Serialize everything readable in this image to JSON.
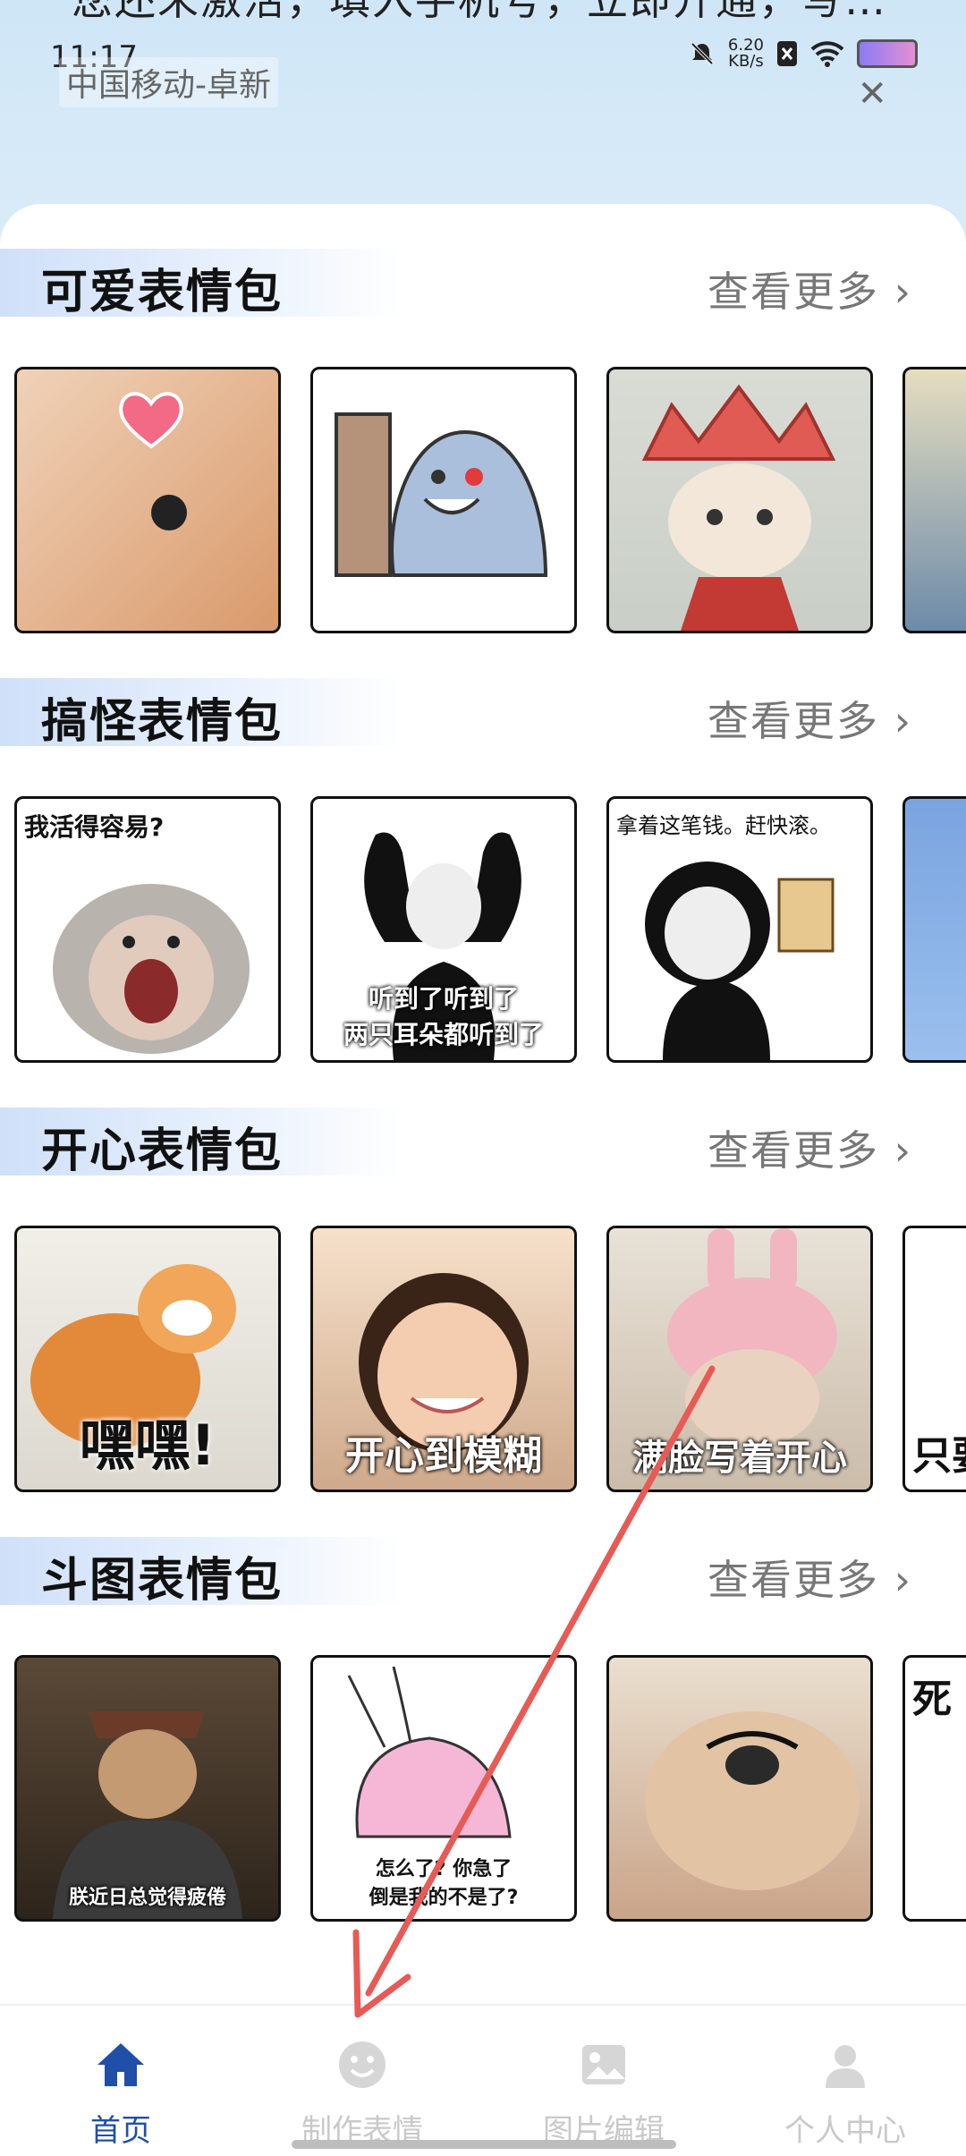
{
  "banner": {
    "text": "您还未激活，填入手机号，立即开通，写…"
  },
  "status_bar": {
    "time": "11:17",
    "carrier": "中国移动-卓新",
    "net_speed_value": "6.20",
    "net_speed_unit": "KB/s"
  },
  "sections": [
    {
      "title": "可爱表情包",
      "more": "查看更多"
    },
    {
      "title": "搞怪表情包",
      "more": "查看更多",
      "captions": [
        "我活得容易?",
        "听到了听到了\n两只耳朵都听到了",
        "拿着这笔钱。赶快滚。"
      ]
    },
    {
      "title": "开心表情包",
      "more": "查看更多",
      "captions": [
        "嘿嘿!",
        "开心到模糊",
        "满脸写着开心",
        "只要"
      ]
    },
    {
      "title": "斗图表情包",
      "more": "查看更多",
      "captions": [
        "朕近日总觉得疲倦",
        "怎么了? 你急了\n倒是我的不是了?",
        "死"
      ]
    }
  ],
  "nav": {
    "items": [
      {
        "label": "首页",
        "icon": "home-icon",
        "active": true
      },
      {
        "label": "制作表情",
        "icon": "smile-icon",
        "active": false
      },
      {
        "label": "图片编辑",
        "icon": "image-icon",
        "active": false
      },
      {
        "label": "个人中心",
        "icon": "person-icon",
        "active": false
      }
    ]
  },
  "colors": {
    "accent": "#1f4fa8",
    "inactive": "#c9c9c9",
    "annotation_arrow": "#e85a55"
  }
}
